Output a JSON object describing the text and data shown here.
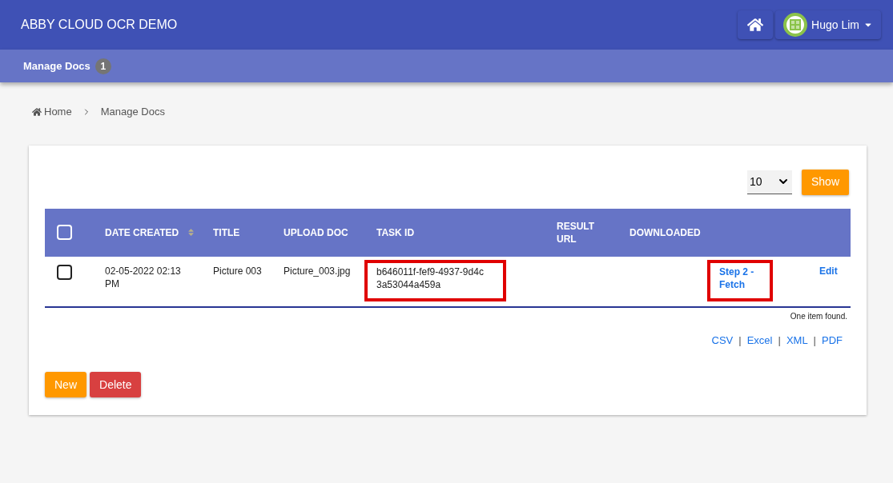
{
  "app_title": "ABBY CLOUD OCR DEMO",
  "user": {
    "name": "Hugo Lim"
  },
  "nav": {
    "label": "Manage Docs",
    "count": "1"
  },
  "breadcrumb": [
    "Home",
    "Manage Docs"
  ],
  "page_size": {
    "value": "10",
    "button": "Show"
  },
  "table": {
    "columns": [
      {
        "kind": "checkbox",
        "checked": false
      },
      {
        "label": "DATE CREATED",
        "kind": "sortable"
      },
      {
        "label": "TITLE",
        "kind": "text"
      },
      {
        "label": "UPLOAD DOC",
        "kind": "text"
      },
      {
        "label": "TASK ID",
        "kind": "text"
      },
      {
        "label": "RESULT URL",
        "kind": "text"
      },
      {
        "label": "DOWNLOADED",
        "kind": "text"
      },
      {
        "kind": "text"
      },
      {
        "kind": "text"
      }
    ],
    "rows": [
      {
        "cells": [
          {
            "kind": "checkbox",
            "checked": false
          },
          {
            "kind": "text",
            "text": "02-05-2022 02:13 PM"
          },
          {
            "kind": "text",
            "text": "Picture 003"
          },
          {
            "kind": "text",
            "text": "Picture_003.jpg"
          },
          {
            "kind": "boxed_text",
            "text": "b646011f-fef9-4937-9d4c 3a53044a459a"
          },
          {
            "kind": "empty"
          },
          {
            "kind": "empty"
          },
          {
            "kind": "boxed_link",
            "text": "Step 2 - Fetch"
          },
          {
            "kind": "link",
            "text": "Edit"
          }
        ]
      }
    ]
  },
  "summary": "One item found.",
  "exports": {
    "separator": "|",
    "items": [
      "CSV",
      "Excel",
      "XML",
      "PDF"
    ]
  },
  "actions": [
    {
      "label": "New",
      "kind": "primary"
    },
    {
      "label": "Delete",
      "kind": "danger"
    }
  ]
}
